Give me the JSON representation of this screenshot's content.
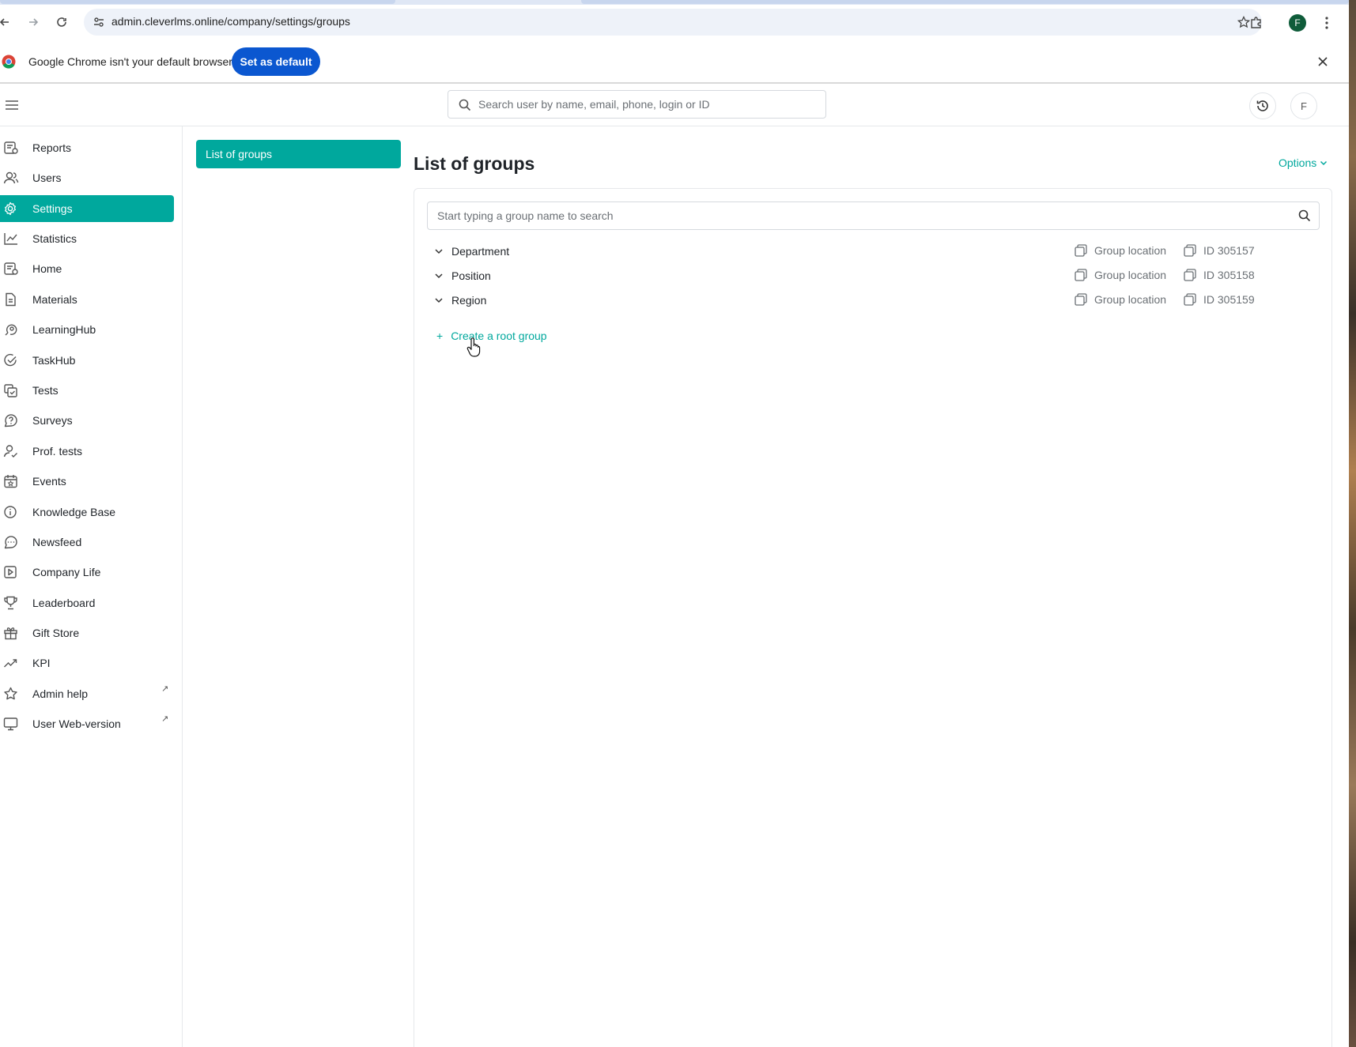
{
  "browser": {
    "url": "admin.cleverlms.online/company/settings/groups",
    "profile_initial": "F"
  },
  "infobar": {
    "message": "Google Chrome isn't your default browser",
    "set_default_label": "Set as default"
  },
  "header": {
    "search_placeholder": "Search user by name, email, phone, login or ID",
    "avatar_initial": "F"
  },
  "sidebar": {
    "items": [
      {
        "label": "Reports",
        "icon": "reports-icon"
      },
      {
        "label": "Users",
        "icon": "users-icon"
      },
      {
        "label": "Settings",
        "icon": "gear-icon",
        "active": true
      },
      {
        "label": "Statistics",
        "icon": "chart-line-icon"
      },
      {
        "label": "Home",
        "icon": "home-icon"
      },
      {
        "label": "Materials",
        "icon": "document-icon"
      },
      {
        "label": "LearningHub",
        "icon": "learninghub-icon"
      },
      {
        "label": "TaskHub",
        "icon": "check-circle-icon"
      },
      {
        "label": "Tests",
        "icon": "tests-icon"
      },
      {
        "label": "Surveys",
        "icon": "question-bubble-icon"
      },
      {
        "label": "Prof. tests",
        "icon": "user-check-icon"
      },
      {
        "label": "Events",
        "icon": "calendar-icon"
      },
      {
        "label": "Knowledge Base",
        "icon": "info-circle-icon"
      },
      {
        "label": "Newsfeed",
        "icon": "chat-bubble-icon"
      },
      {
        "label": "Company Life",
        "icon": "play-square-icon"
      },
      {
        "label": "Leaderboard",
        "icon": "trophy-icon"
      },
      {
        "label": "Gift Store",
        "icon": "gift-icon"
      },
      {
        "label": "KPI",
        "icon": "trending-up-icon"
      },
      {
        "label": "Admin help",
        "icon": "star-icon",
        "external": true
      },
      {
        "label": "User Web-version",
        "icon": "monitor-icon",
        "external": true
      }
    ],
    "external_glyph": "↗"
  },
  "subnav": {
    "active_label": "List of groups"
  },
  "main": {
    "title": "List of groups",
    "options_label": "Options",
    "group_search_placeholder": "Start typing a group name to search",
    "groups": [
      {
        "name": "Department",
        "location_label": "Group location",
        "id_label": "ID 305157"
      },
      {
        "name": "Position",
        "location_label": "Group location",
        "id_label": "ID 305158"
      },
      {
        "name": "Region",
        "location_label": "Group location",
        "id_label": "ID 305159"
      }
    ],
    "create_root_label": "Create a root group",
    "create_root_glyph": "+"
  },
  "colors": {
    "accent": "#00a89d",
    "chrome_blue": "#0b57d0"
  }
}
